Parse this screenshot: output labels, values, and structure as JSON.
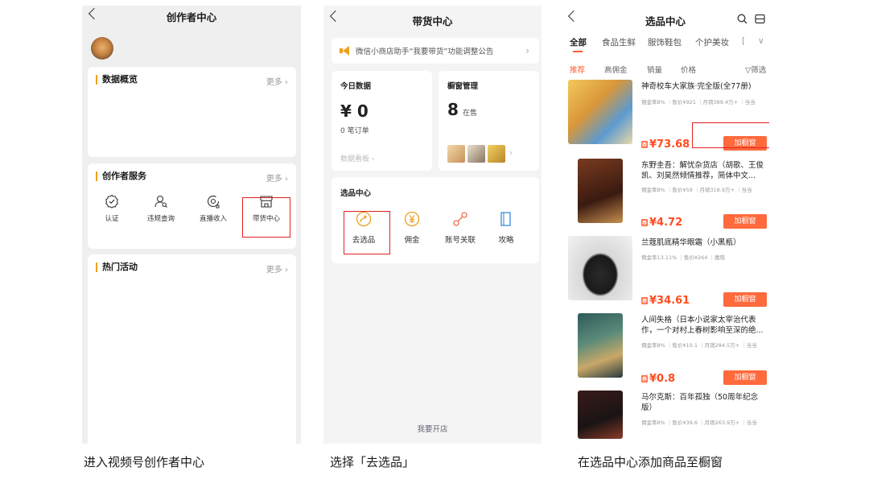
{
  "panel1": {
    "title": "创作者中心",
    "overview_title": "数据概览",
    "services_title": "创作者服务",
    "events_title": "热门活动",
    "more": "更多",
    "services": [
      {
        "label": "认证",
        "icon": "verified-badge-icon"
      },
      {
        "label": "违规查询",
        "icon": "user-search-icon"
      },
      {
        "label": "直播收入",
        "icon": "live-income-icon"
      },
      {
        "label": "带货中心",
        "icon": "shop-icon"
      }
    ],
    "caption": "进入视频号创作者中心"
  },
  "panel2": {
    "title": "带货中心",
    "notice": "微信小商店助手“我要带货”功能调整公告",
    "today_title": "今日数据",
    "today_amount": "¥ 0",
    "today_orders": "0 笔订单",
    "today_link": "数据看板 ›",
    "window_title": "橱窗管理",
    "window_count": "8",
    "window_unit": "在售",
    "center_title": "选品中心",
    "tools": [
      {
        "label": "去选品",
        "icon": "select-product-icon"
      },
      {
        "label": "佣金",
        "icon": "yuan-coin-icon"
      },
      {
        "label": "账号关联",
        "icon": "link-icon"
      },
      {
        "label": "攻略",
        "icon": "book-icon"
      }
    ],
    "open_shop": "我要开店",
    "caption": "选择「去选品」"
  },
  "panel3": {
    "title": "选品中心",
    "tabs": [
      "全部",
      "食品生鲜",
      "服饰鞋包",
      "个护美妆",
      "[",
      "∨"
    ],
    "filters": [
      "推荐",
      "高佣金",
      "销量",
      "价格",
      "▽筛选"
    ],
    "add_label": "加橱窗",
    "products": [
      {
        "title": "神奇校车大家族·完全版(全77册)",
        "meta": "佣金率8% ｜售价¥921 ｜月销389.4万+ ｜当当",
        "price": "¥73.68",
        "tag": "券"
      },
      {
        "title": "东野圭吾：解忧杂货店（胡歌、王俊凯、刘昊然倾情推荐，简体中文...",
        "meta": "佣金率8% ｜售价¥59 ｜月销318.9万+ ｜当当",
        "price": "¥4.72",
        "tag": "券"
      },
      {
        "title": "兰蔻肌底精华眼霜（小黑瓶）",
        "meta": "佣金率13.11% ｜售价¥264 ｜魔筷",
        "price": "¥34.61",
        "tag": "券"
      },
      {
        "title": "人间失格（日本小说家太宰治代表作，一个对村上春树影响至深的绝...",
        "meta": "佣金率8% ｜售价¥10.1 ｜月销284.5万+ ｜当当",
        "price": "¥0.8",
        "tag": "券"
      },
      {
        "title": "马尔克斯：百年孤独（50周年纪念版）",
        "meta": "佣金率8% ｜售价¥39.6 ｜月销263.9万+ ｜当当",
        "price": "",
        "tag": ""
      }
    ],
    "caption": "在选品中心添加商品至橱窗"
  },
  "colors": {
    "accent": "#ff6a3d",
    "highlight": "#e02020",
    "section_bar": "#f0a020"
  }
}
